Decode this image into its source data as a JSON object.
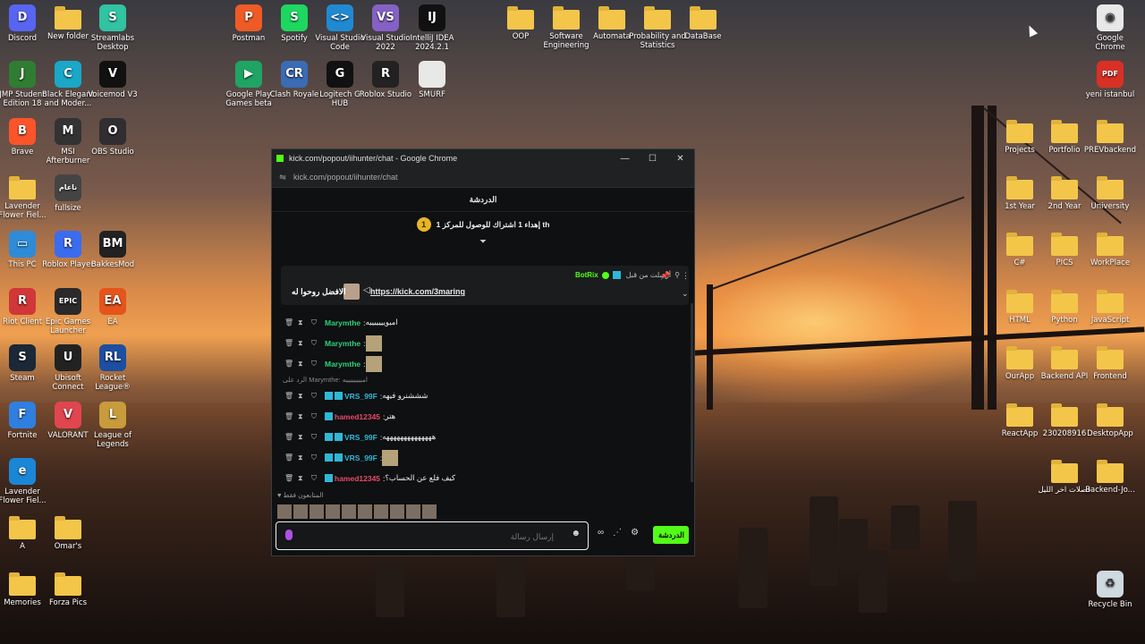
{
  "desktop": {
    "icons_left": [
      {
        "label": "Discord",
        "color": "#5865f2",
        "glyph": "D"
      },
      {
        "label": "New folder",
        "color": "folder",
        "glyph": ""
      },
      {
        "label": "Streamlabs Desktop",
        "color": "#31c3a2",
        "glyph": "S"
      },
      {
        "label": "JMP Student Edition 18",
        "color": "#2f7d32",
        "glyph": "J"
      },
      {
        "label": "Black Elegant and Moder...",
        "color": "#1ba7c7",
        "glyph": "C"
      },
      {
        "label": "Voicemod V3",
        "color": "#111111",
        "glyph": "V"
      },
      {
        "label": "Brave",
        "color": "#fb542b",
        "glyph": "B"
      },
      {
        "label": "MSI Afterburner",
        "color": "#333333",
        "glyph": "M"
      },
      {
        "label": "OBS Studio",
        "color": "#302e31",
        "glyph": "O"
      },
      {
        "label": "Lavender Flower Fiel...",
        "color": "folder",
        "glyph": ""
      },
      {
        "label": "fullsize",
        "color": "#444444",
        "glyph": "ناعام"
      },
      {
        "label": "This PC",
        "color": "#2e8bd8",
        "glyph": "▭"
      },
      {
        "label": "Roblox Player",
        "color": "#3b6cf0",
        "glyph": "R"
      },
      {
        "label": "BakkesMod",
        "color": "#222222",
        "glyph": "BM"
      },
      {
        "label": "Riot Client",
        "color": "#d13639",
        "glyph": "R"
      },
      {
        "label": "Epic Games Launcher",
        "color": "#2a2a2a",
        "glyph": "EPIC"
      },
      {
        "label": "EA",
        "color": "#e5541b",
        "glyph": "EA"
      },
      {
        "label": "Steam",
        "color": "#1b2838",
        "glyph": "S"
      },
      {
        "label": "Ubisoft Connect",
        "color": "#222222",
        "glyph": "U"
      },
      {
        "label": "Rocket League®",
        "color": "#1d4ea0",
        "glyph": "RL"
      },
      {
        "label": "Fortnite",
        "color": "#2f7fe0",
        "glyph": "F"
      },
      {
        "label": "VALORANT",
        "color": "#e04550",
        "glyph": "V"
      },
      {
        "label": "League of Legends",
        "color": "#c89b3c",
        "glyph": "L"
      },
      {
        "label": "Lavender Flower Fiel...",
        "color": "#1c86d6",
        "glyph": "e"
      },
      {
        "label": "A",
        "color": "folder",
        "glyph": ""
      },
      {
        "label": "Omar's",
        "color": "folder",
        "glyph": ""
      },
      {
        "label": "Memories",
        "color": "folder",
        "glyph": ""
      },
      {
        "label": "Forza Pics",
        "color": "folder",
        "glyph": ""
      }
    ],
    "icons_top": [
      {
        "label": "Postman",
        "color": "#ef5b25",
        "glyph": "P"
      },
      {
        "label": "Spotify",
        "color": "#1ed760",
        "glyph": "S"
      },
      {
        "label": "Visual Studio Code",
        "color": "#1f8ad2",
        "glyph": "<>"
      },
      {
        "label": "Visual Studio 2022",
        "color": "#8661c5",
        "glyph": "VS"
      },
      {
        "label": "IntelliJ IDEA 2024.2.1",
        "color": "#111111",
        "glyph": "IJ"
      },
      {
        "label": "Google Play Games beta",
        "color": "#1fa463",
        "glyph": "▶"
      },
      {
        "label": "Clash Royale",
        "color": "#3b6bb5",
        "glyph": "CR"
      },
      {
        "label": "Logitech G HUB",
        "color": "#111111",
        "glyph": "G"
      },
      {
        "label": "Roblox Studio",
        "color": "#222222",
        "glyph": "R"
      },
      {
        "label": "SMURF",
        "color": "#e8e8e8",
        "glyph": ""
      },
      {
        "label": "OOP",
        "color": "folder",
        "glyph": ""
      },
      {
        "label": "Software Engineering",
        "color": "folder",
        "glyph": ""
      },
      {
        "label": "Automata",
        "color": "folder",
        "glyph": ""
      },
      {
        "label": "Probability and Statistics",
        "color": "folder",
        "glyph": ""
      },
      {
        "label": "DataBase",
        "color": "folder",
        "glyph": ""
      }
    ],
    "icons_right": [
      {
        "label": "Google Chrome",
        "color": "#e8e8e8",
        "glyph": "◉"
      },
      {
        "label": "yeni istanbul",
        "color": "#d93025",
        "glyph": "PDF"
      },
      {
        "label": "Projects",
        "color": "folder",
        "glyph": ""
      },
      {
        "label": "Portfolio",
        "color": "folder",
        "glyph": ""
      },
      {
        "label": "PREVbackend",
        "color": "folder",
        "glyph": ""
      },
      {
        "label": "1st Year",
        "color": "folder",
        "glyph": ""
      },
      {
        "label": "2nd Year",
        "color": "folder",
        "glyph": ""
      },
      {
        "label": "University",
        "color": "folder",
        "glyph": ""
      },
      {
        "label": "C#",
        "color": "folder",
        "glyph": ""
      },
      {
        "label": "PICS",
        "color": "folder",
        "glyph": ""
      },
      {
        "label": "WorkPlace",
        "color": "folder",
        "glyph": ""
      },
      {
        "label": "HTML",
        "color": "folder",
        "glyph": ""
      },
      {
        "label": "Python",
        "color": "folder",
        "glyph": ""
      },
      {
        "label": "JavaScript",
        "color": "folder",
        "glyph": ""
      },
      {
        "label": "OurApp",
        "color": "folder",
        "glyph": ""
      },
      {
        "label": "Backend API",
        "color": "folder",
        "glyph": ""
      },
      {
        "label": "Frontend",
        "color": "folder",
        "glyph": ""
      },
      {
        "label": "ReactApp",
        "color": "folder",
        "glyph": ""
      },
      {
        "label": "230208916",
        "color": "folder",
        "glyph": ""
      },
      {
        "label": "DesktopApp",
        "color": "folder",
        "glyph": ""
      },
      {
        "label": "فصلات اخر الليل",
        "color": "folder",
        "glyph": ""
      },
      {
        "label": "Backend-Jo...",
        "color": "folder",
        "glyph": ""
      },
      {
        "label": "Recycle Bin",
        "color": "#d0d8e0",
        "glyph": "♻"
      }
    ]
  },
  "window": {
    "title": "kick.com/popout/iihunter/chat - Google Chrome",
    "url": "kick.com/popout/iihunter/chat",
    "chat_header": "الدردشة",
    "goal_badge": "1",
    "goal_text": "إهداء 1 اشتراك للوصول للمركز 1 th",
    "pinned": {
      "bot_name": "BotRix",
      "sent_label": "أرسلت من قبل",
      "link": "https://kick.com/3maring",
      "text": "الافضل روحوا له"
    },
    "messages": [
      {
        "user": "Marymthe",
        "color": "#2fd07a",
        "text": "امبويييييييه",
        "sticker": false,
        "badges": 0
      },
      {
        "user": "Marymthe",
        "color": "#2fd07a",
        "text": "",
        "sticker": true,
        "badges": 0
      },
      {
        "user": "Marymthe",
        "color": "#2fd07a",
        "text": "",
        "sticker": true,
        "badges": 0
      },
      {
        "user": "VRS_99F",
        "color": "#2fb7d8",
        "text": "شششنرو فيهه",
        "sticker": false,
        "badges": 2,
        "reply": "الرد على Marymthe: امبيييييييه"
      },
      {
        "user": "hamed12345",
        "color": "#e84a6a",
        "text": "هتر",
        "sticker": false,
        "badges": 1
      },
      {
        "user": "VRS_99F",
        "color": "#2fb7d8",
        "text": "ههههههههههههههه",
        "sticker": false,
        "badges": 2
      },
      {
        "user": "VRS_99F",
        "color": "#2fb7d8",
        "text": "",
        "sticker": true,
        "badges": 2
      },
      {
        "user": "hamed12345",
        "color": "#e84a6a",
        "text": "كيف فلع عن الحساب؟",
        "sticker": false,
        "badges": 1
      }
    ],
    "supporters_label": "المتابعون فقط",
    "input_placeholder": "إرسال رسالة",
    "send_label": "الدردشة"
  }
}
